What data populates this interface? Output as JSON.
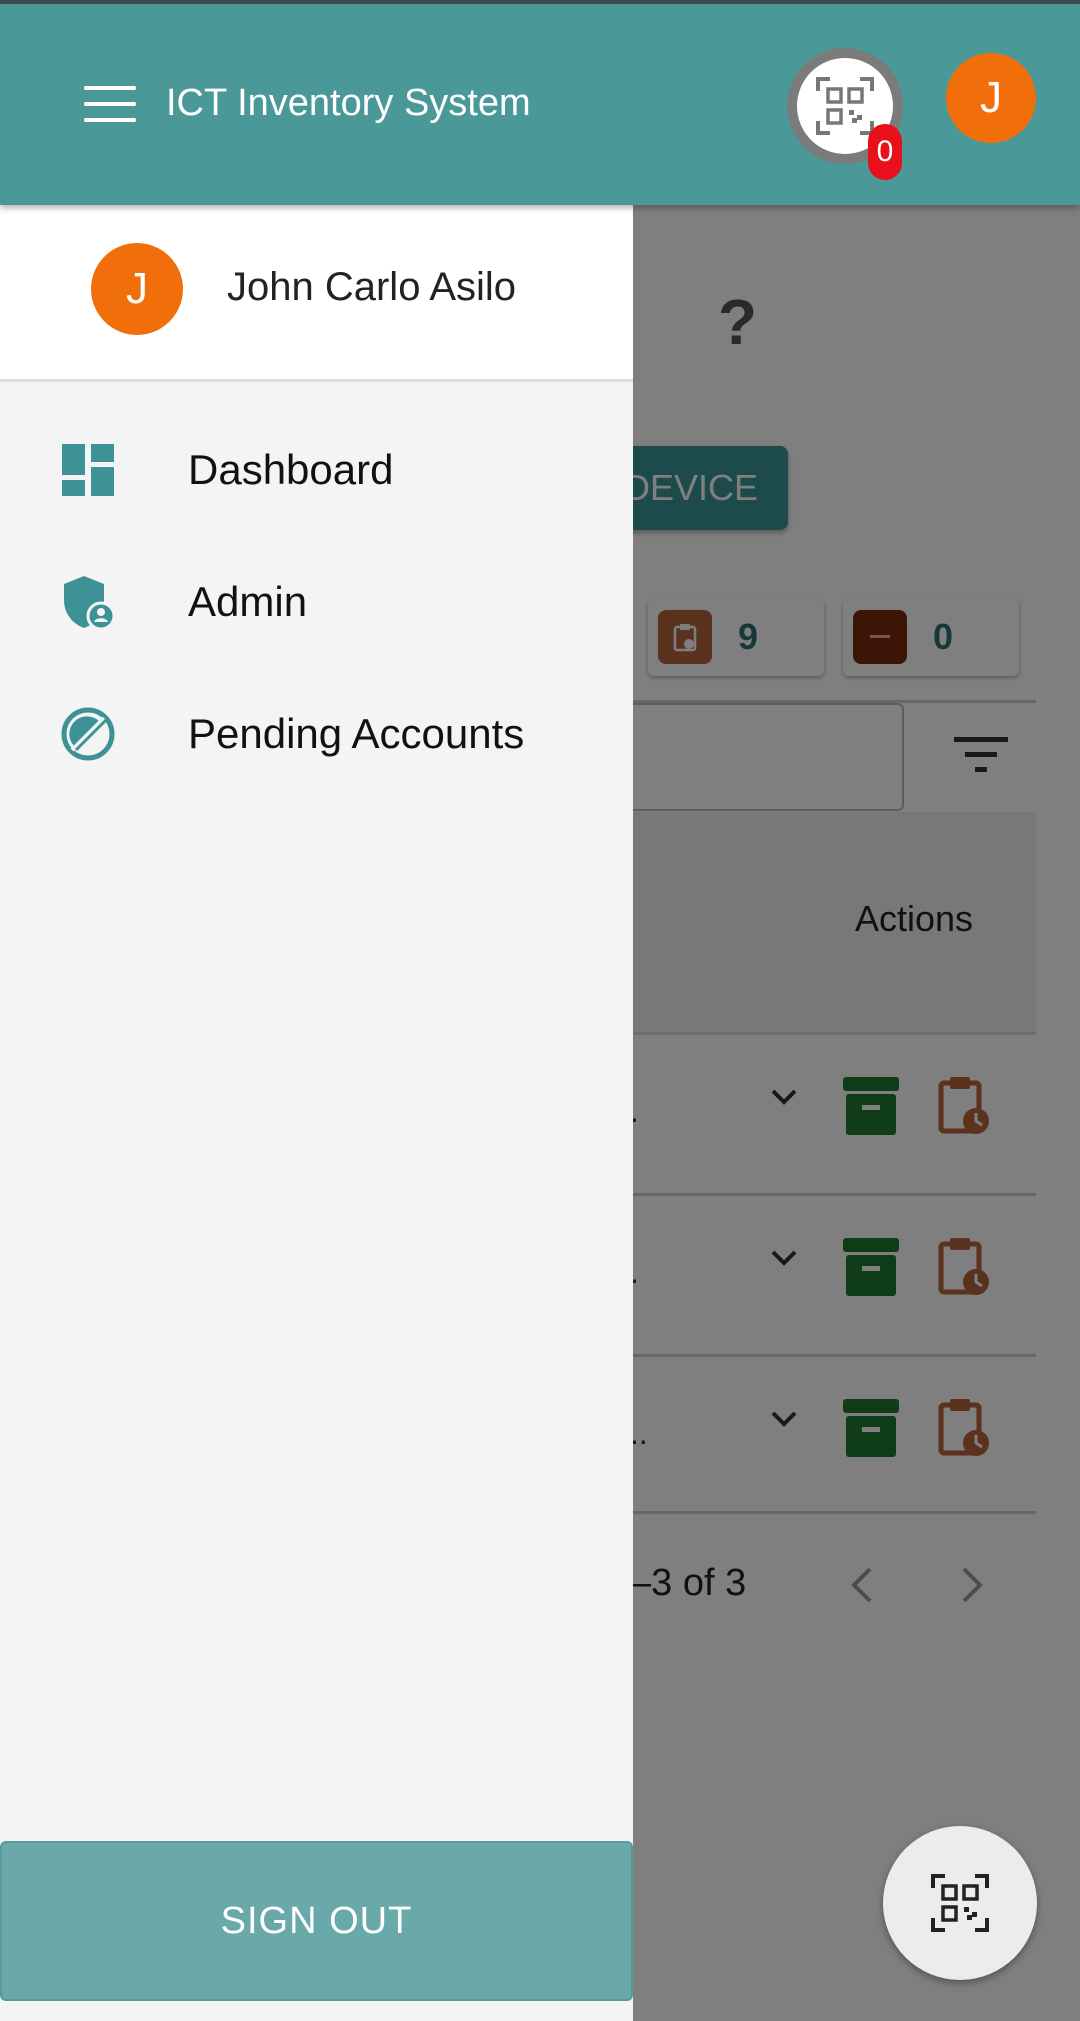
{
  "app": {
    "title": "ICT Inventory System",
    "avatar_initial": "J",
    "qr_badge_count": "0"
  },
  "drawer": {
    "user": {
      "initial": "J",
      "name": "John Carlo Asilo"
    },
    "items": [
      {
        "label": "Dashboard",
        "icon": "dashboard-icon"
      },
      {
        "label": "Admin",
        "icon": "admin-shield-icon"
      },
      {
        "label": "Pending Accounts",
        "icon": "pending-accounts-icon"
      }
    ],
    "signout_label": "SIGN OUT"
  },
  "background": {
    "help_mark": "?",
    "add_device_label": "DEVICE",
    "stats": [
      {
        "value": "9",
        "color": "#b4643a"
      },
      {
        "value": "0",
        "color": "#7a2a0e"
      }
    ],
    "actions_header": "Actions",
    "rows": [
      {
        "text": "."
      },
      {
        "text": "."
      },
      {
        "text": ".."
      }
    ],
    "pagination": "–3 of 3"
  },
  "colors": {
    "primary": "#4a9898",
    "accent": "#f06f0a",
    "badge": "#e8101a",
    "archive": "#1f7a2e",
    "pending": "#b4643a"
  }
}
